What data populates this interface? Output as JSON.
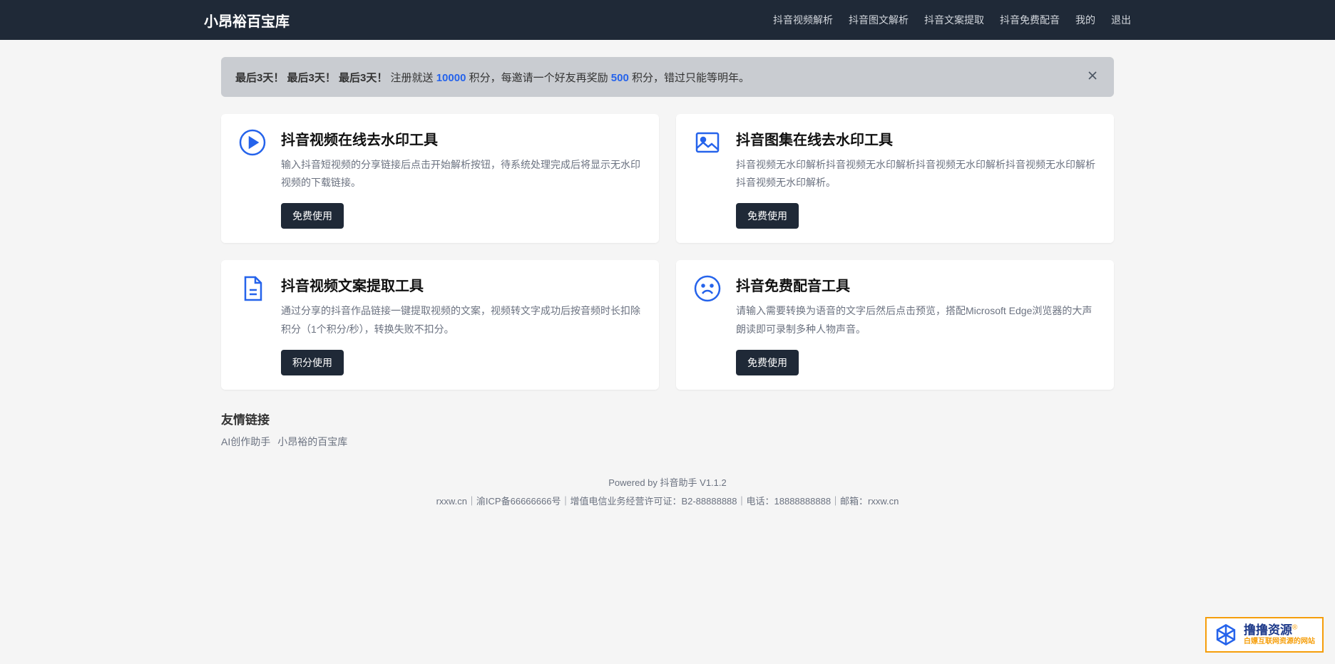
{
  "brand": "小昂裕百宝库",
  "nav": {
    "items": [
      "抖音视频解析",
      "抖音图文解析",
      "抖音文案提取",
      "抖音免费配音",
      "我的",
      "退出"
    ]
  },
  "alert": {
    "strong1": "最后3天！",
    "strong2": "最后3天！",
    "strong3": "最后3天！",
    "text1": "注册就送 ",
    "hl1": "10000",
    "text2": " 积分，每邀请一个好友再奖励 ",
    "hl2": "500",
    "text3": " 积分，错过只能等明年。"
  },
  "cards": [
    {
      "title": "抖音视频在线去水印工具",
      "desc": "输入抖音短视频的分享链接后点击开始解析按钮，待系统处理完成后将显示无水印视频的下载链接。",
      "btn": "免费使用",
      "icon": "play"
    },
    {
      "title": "抖音图集在线去水印工具",
      "desc": "抖音视频无水印解析抖音视频无水印解析抖音视频无水印解析抖音视频无水印解析抖音视频无水印解析。",
      "btn": "免费使用",
      "icon": "image"
    },
    {
      "title": "抖音视频文案提取工具",
      "desc": "通过分享的抖音作品链接一键提取视频的文案，视频转文字成功后按音频时长扣除积分（1个积分/秒），转换失败不扣分。",
      "btn": "积分使用",
      "icon": "document"
    },
    {
      "title": "抖音免费配音工具",
      "desc": "请输入需要转换为语音的文字后然后点击预览，搭配Microsoft Edge浏览器的大声朗读即可录制多种人物声音。",
      "btn": "免费使用",
      "icon": "face"
    }
  ],
  "friend_links": {
    "title": "友情链接",
    "items": [
      "AI创作助手",
      "小昂裕的百宝库"
    ]
  },
  "footer": {
    "powered_by": "Powered by ",
    "app_name": "抖音助手",
    "version": " V1.1.2",
    "line2": "rxxw.cn｜渝ICP备66666666号｜增值电信业务经营许可证：B2-88888888｜电话：18888888888｜邮箱：rxxw.cn"
  },
  "watermark": {
    "main": "撸撸资源",
    "sup": "®",
    "sub": "白嫖互联网资源的网站"
  }
}
